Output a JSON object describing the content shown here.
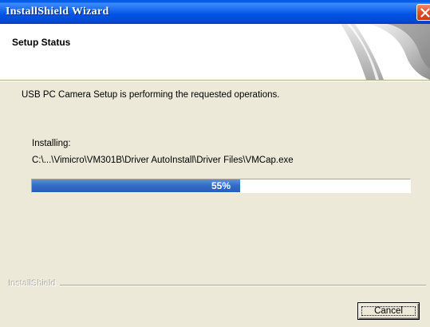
{
  "window": {
    "title": "InstallShield Wizard",
    "close_icon": "close-icon"
  },
  "header": {
    "title": "Setup Status",
    "graphic_icon": "installshield-swirl-graphic"
  },
  "main": {
    "message": "USB PC Camera Setup is performing the requested operations.",
    "installing_label": "Installing:",
    "file_path": "C:\\...\\Vimicro\\VM301B\\Driver AutoInstall\\Driver Files\\VMCap.exe",
    "progress": {
      "percent": 55,
      "label": "55%"
    }
  },
  "footer": {
    "brand": "InstallShield",
    "cancel_label": "Cancel"
  },
  "colors": {
    "titlebar": "#0055e5",
    "progress_fill": "#316ac5",
    "window_bg": "#ece9d8",
    "close_button": "#e5512f"
  }
}
